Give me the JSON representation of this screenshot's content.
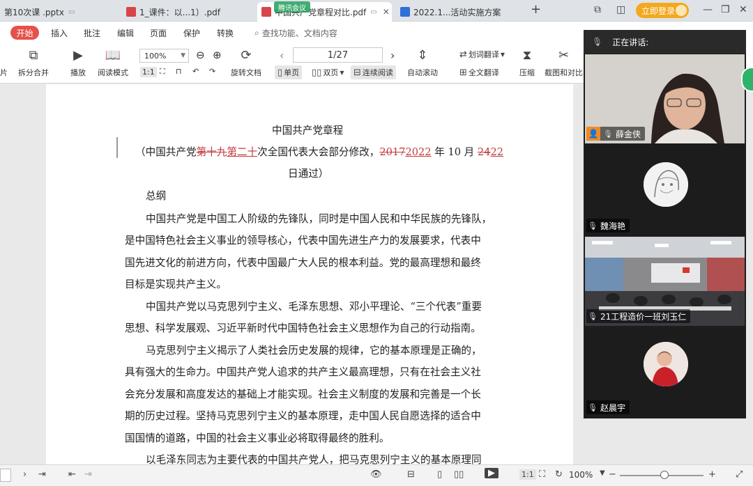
{
  "tabs": [
    {
      "label": "第10次课  .pptx",
      "color": "#e5743a"
    },
    {
      "label": "1_课件：以...1）.pdf",
      "color": "#d9434a"
    },
    {
      "label": "中国共产党章程对比.pdf",
      "color": "#d9434a"
    },
    {
      "label": "2022.1...活动实施方案",
      "color": "#2f6fd6"
    }
  ],
  "meeting_badge": "腾讯会议",
  "new_tab": "+",
  "login_button": "立即登录",
  "menu": {
    "start": "开始",
    "items": [
      "插入",
      "批注",
      "编辑",
      "页面",
      "保护",
      "转换"
    ],
    "search": "查找功能、文档内容"
  },
  "toolbar": {
    "cut_left": "片",
    "split_merge": "拆分合并",
    "play": "播放",
    "read_mode": "阅读模式",
    "zoom": "100%",
    "rotate": "旋转文档",
    "page": "1/27",
    "single_page": "单页",
    "double_page": "双页",
    "continuous": "连续阅读",
    "auto_scroll": "自动滚动",
    "word_translate": "划词翻译",
    "full_translate": "全文翻译",
    "compress": "压缩",
    "screenshot_compare": "截图和对比"
  },
  "document": {
    "title": "中国共产党章程",
    "sub_open": "（中国共产党",
    "sub_del1": "第十九",
    "sub_ins1": "第二十",
    "sub_mid": "次全国代表大会部分修改，",
    "sub_del2": "2017",
    "sub_ins2": "2022",
    "sub_month": " 年 10 月 ",
    "sub_del3": "24",
    "sub_ins3": "22",
    "sub_close": "日通过）",
    "section": "总纲",
    "lines": [
      "中国共产党是中国工人阶级的先锋队，同时是中国人民和中华民族的先锋队，",
      "是中国特色社会主义事业的领导核心，代表中国先进生产力的发展要求，代表中",
      "国先进文化的前进方向，代表中国最广大人民的根本利益。党的最高理想和最终",
      "目标是实现共产主义。",
      "中国共产党以马克思列宁主义、毛泽东思想、邓小平理论、“三个代表”重要",
      "思想、科学发展观、习近平新时代中国特色社会主义思想作为自己的行动指南。",
      "马克思列宁主义揭示了人类社会历史发展的规律，它的基本原理是正确的，",
      "具有强大的生命力。中国共产党人追求的共产主义最高理想，只有在社会主义社",
      "会充分发展和高度发达的基础上才能实现。社会主义制度的发展和完善是一个长",
      "期的历史过程。坚持马克思列宁主义的基本原理，走中国人民自愿选择的适合中",
      "国国情的道路，中国的社会主义事业必将取得最终的胜利。",
      "以毛泽东同志为主要代表的中国共产党人，把马克思列宁主义的基本原理同"
    ]
  },
  "meeting": {
    "header": "正在讲话:",
    "participants": [
      {
        "name": "薛金侠"
      },
      {
        "name": "魏海艳"
      },
      {
        "name": "21工程造价一班刘玉仁"
      },
      {
        "name": "赵晨宇"
      }
    ]
  },
  "status": {
    "zoom": "100%"
  },
  "colors": {
    "accent_red": "#e5514a",
    "track_changes": "#c23a3a",
    "login_orange": "#f3a81f"
  }
}
